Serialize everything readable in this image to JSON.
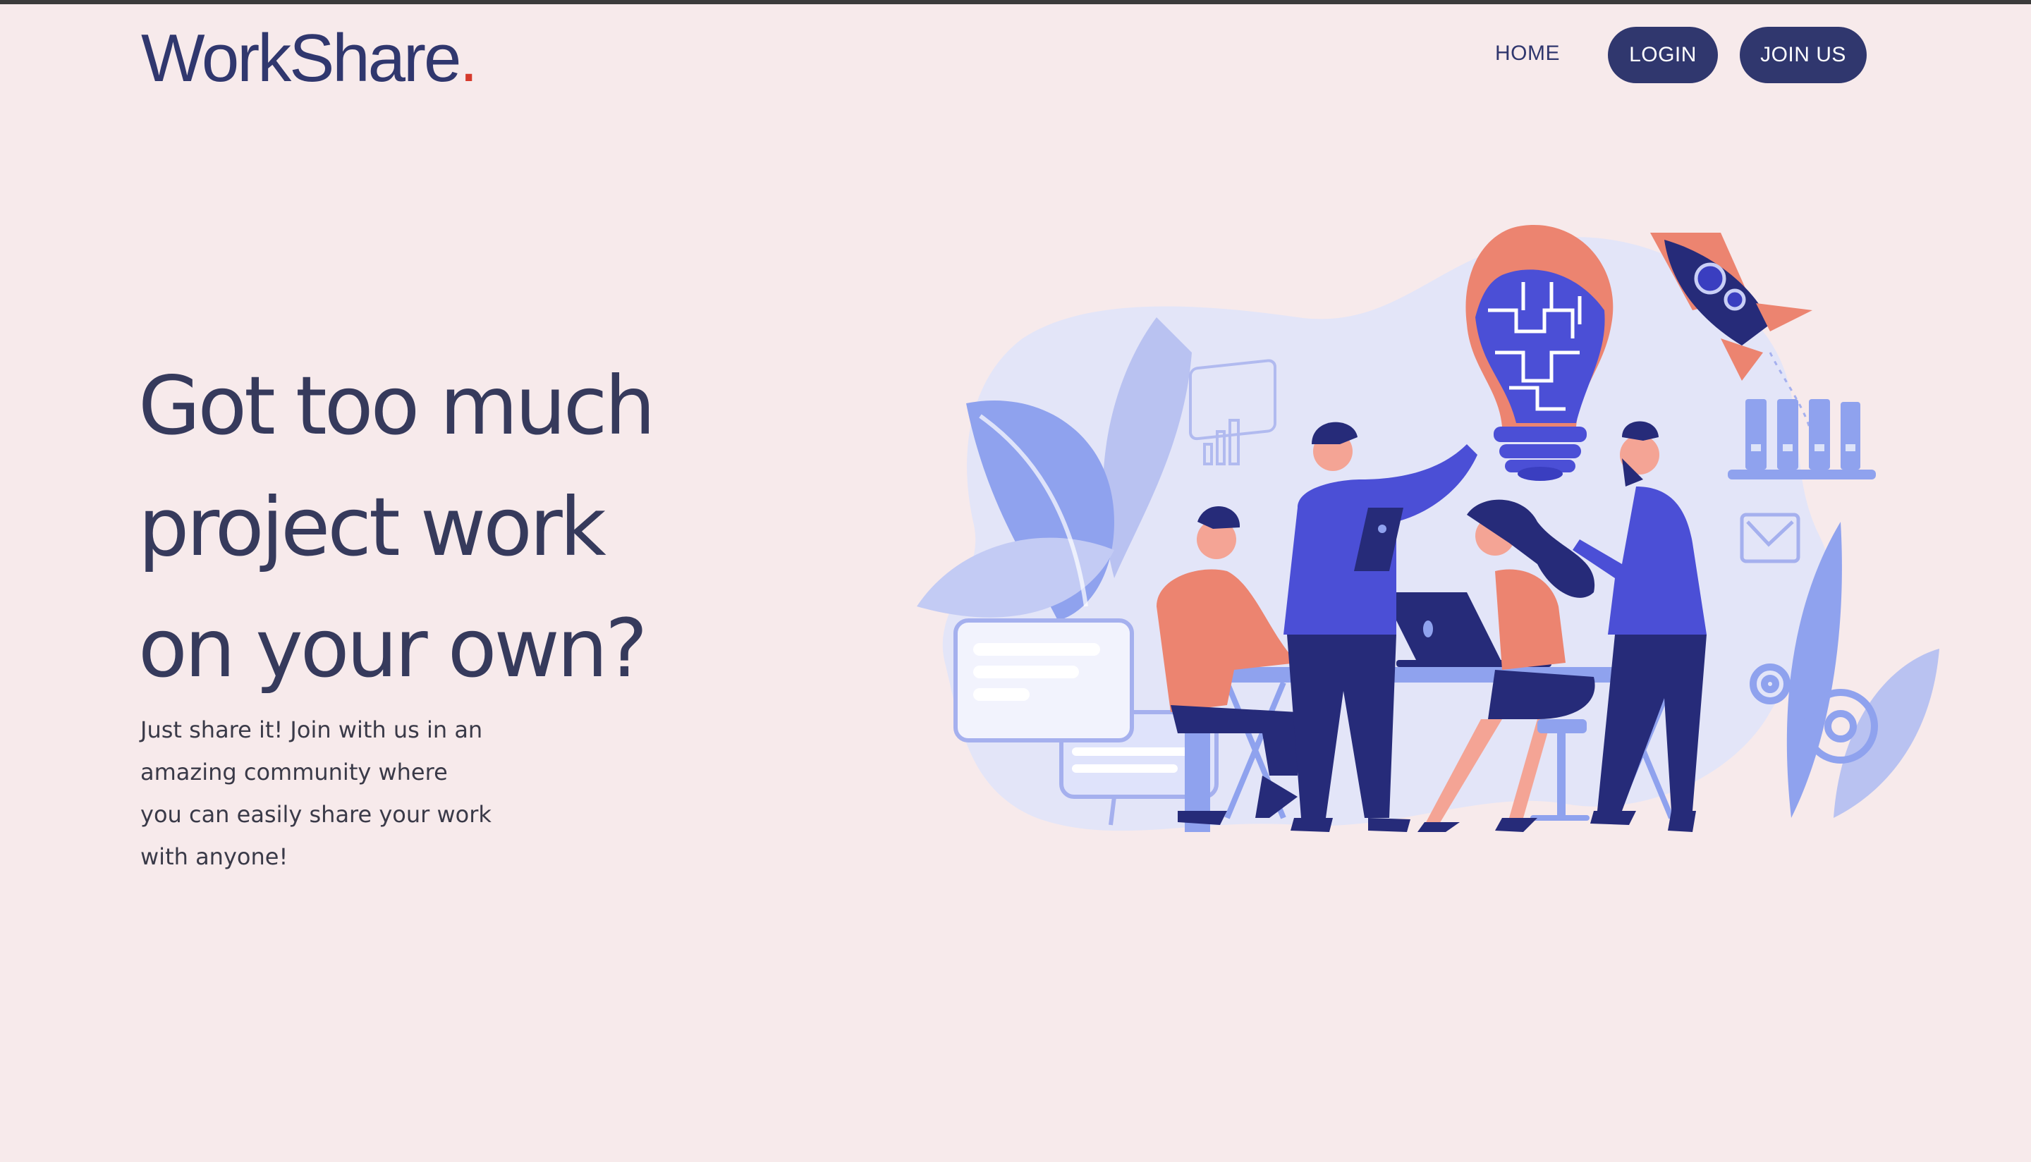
{
  "brand": {
    "name": "WorkShare",
    "dot": "."
  },
  "nav": {
    "home": "HOME",
    "login": "LOGIN",
    "join": "JOIN US"
  },
  "hero": {
    "title_lines": [
      "Got too much",
      "project work",
      "on your own?"
    ],
    "description_lines": [
      "Just share it! Join with us in an",
      "amazing community where",
      "you can easily share your work",
      "with anyone!"
    ]
  },
  "illustration": {
    "icons": [
      "team-meeting-illustration",
      "lightbulb-puzzle-icon",
      "rocket-icon",
      "bar-chart-icon",
      "checkbox-icon",
      "gear-icon",
      "binders-shelf-icon",
      "laptop-icon",
      "tablet-icon"
    ]
  },
  "colors": {
    "background": "#f7eaeb",
    "brand_navy": "#30376e",
    "heading": "#363a5c",
    "accent_red": "#d63a2c",
    "illustration_blue": "#4b4fd6",
    "illustration_coral": "#ec8470"
  }
}
